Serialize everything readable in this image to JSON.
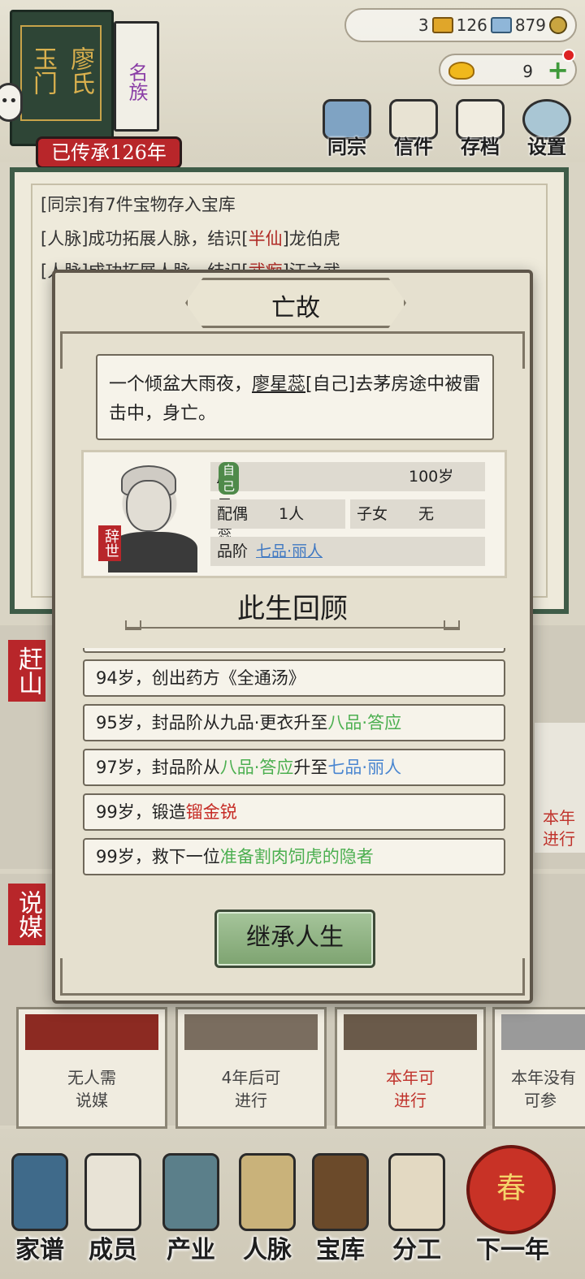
{
  "clan": {
    "name_chars": [
      "玉门",
      "廖氏"
    ],
    "famous_label": "名族",
    "inherited_label": "已传承126年"
  },
  "resources": {
    "copper": "3",
    "silver": "126",
    "coins": "879",
    "gold": "9"
  },
  "top_menu": [
    {
      "label": "同宗",
      "icon": "books-icon"
    },
    {
      "label": "信件",
      "icon": "letter-icon"
    },
    {
      "label": "存档",
      "icon": "save-icon"
    },
    {
      "label": "设置",
      "icon": "gear-icon"
    }
  ],
  "log": [
    {
      "prefix": "[同宗]有7件宝物存入宝库",
      "hl": "",
      "suffix": ""
    },
    {
      "prefix": "[人脉]成功拓展人脉，结识[",
      "hl": "半仙",
      "suffix": "]龙伯虎"
    },
    {
      "prefix": "[人脉]成功拓展人脉，结识[",
      "hl": "武痴",
      "suffix": "]汪之武"
    }
  ],
  "side_tags": [
    "赶山",
    "说媒"
  ],
  "bg_cards": [
    {
      "line1": "无人需",
      "line2": "说媒"
    },
    {
      "line1": "4年后可",
      "line2": "进行"
    },
    {
      "line1": "本年可",
      "line2": "进行"
    },
    {
      "line1": "本年没有",
      "line2": "可参"
    }
  ],
  "bg_right_card": {
    "line1": "本年",
    "line2": "进行"
  },
  "bottom_nav": [
    "家谱",
    "成员",
    "产业",
    "人脉",
    "宝库",
    "分工",
    "下一年"
  ],
  "spring_label": "春",
  "modal": {
    "title": "亡故",
    "event": {
      "before": "一个倾盆大雨夜，",
      "name": "廖星蕊",
      "after": "[自己]去茅房途中被雷击中，身亡。"
    },
    "profile": {
      "name": "廖星蕊",
      "self_badge": "自己",
      "age": "100岁",
      "spouse_label": "配偶",
      "spouse_value": "1人",
      "children_label": "子女",
      "children_value": "无",
      "rank_label": "品阶",
      "rank_value": "七品·丽人",
      "deceased_tag": "辞世"
    },
    "review_title": "此生回顾",
    "life_events": [
      [
        {
          "t": "94岁，创出药方《全通汤》",
          "c": ""
        }
      ],
      [
        {
          "t": "95岁，封品阶从九品·更衣升至",
          "c": ""
        },
        {
          "t": "八品·答应",
          "c": "green"
        }
      ],
      [
        {
          "t": "97岁，封品阶从",
          "c": ""
        },
        {
          "t": "八品·答应",
          "c": "green"
        },
        {
          "t": "升至",
          "c": ""
        },
        {
          "t": "七品·丽人",
          "c": "blue"
        }
      ],
      [
        {
          "t": "99岁，锻造",
          "c": ""
        },
        {
          "t": "镏金锐",
          "c": "red"
        }
      ],
      [
        {
          "t": "99岁，救下一位",
          "c": ""
        },
        {
          "t": "准备割肉饲虎的隐者",
          "c": "green"
        }
      ]
    ],
    "inherit_button": "继承人生"
  }
}
